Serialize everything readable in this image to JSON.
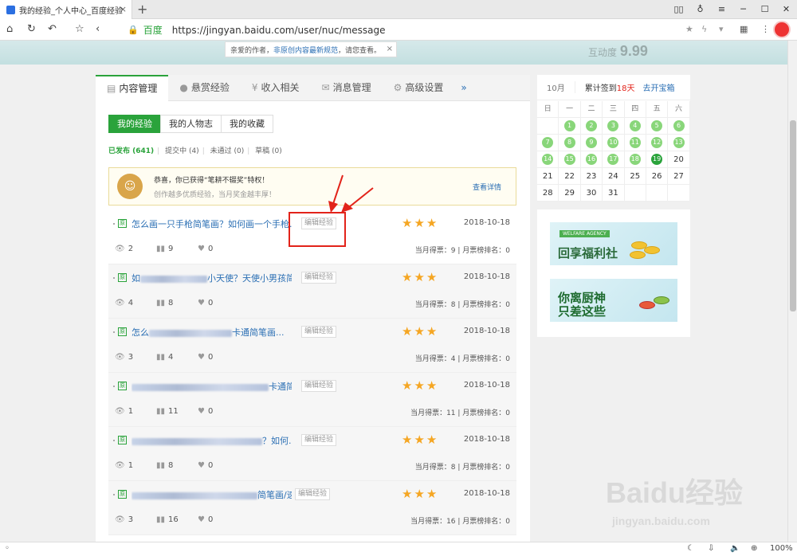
{
  "browser": {
    "tab_title": "我的经验_个人中心_百度经验",
    "tab_close": "×",
    "new_tab": "+",
    "site_label": "百度",
    "url": "https://jingyan.baidu.com/user/nuc/message",
    "zoom": "100%"
  },
  "banner": {
    "notice_prefix": "亲爱的作者，",
    "notice_link": "非原创内容最新规范",
    "notice_suffix": "，请您查看。",
    "close": "×",
    "score_label": "互动度",
    "score_value": "9.99"
  },
  "tabs": [
    {
      "icon": "▤",
      "label": "内容管理"
    },
    {
      "icon": "●",
      "label": "悬赏经验"
    },
    {
      "icon": "¥",
      "label": "收入相关"
    },
    {
      "icon": "✉",
      "label": "消息管理"
    },
    {
      "icon": "⚙",
      "label": "高级设置"
    },
    {
      "icon": "»",
      "label": ""
    }
  ],
  "subtabs": [
    "我的经验",
    "我的人物志",
    "我的收藏"
  ],
  "filters": {
    "published": "已发布 (641)",
    "submitting": "提交中 (4)",
    "rejected": "未通过 (0)",
    "draft": "草稿 (0)",
    "sep": "|"
  },
  "honor": {
    "line1": "恭喜，你已获得“笔耕不辍奖”特权！",
    "line2": "创作越多优质经验，当月奖金越丰厚！",
    "detail": "查看详情"
  },
  "items": [
    {
      "badge": "原",
      "title_pre": "怎么画一只手枪简笔画？如何画一个手枪...",
      "title_post": "",
      "edit": "编辑经验",
      "date": "2018-10-18",
      "views": "2",
      "votes": "9",
      "likes": "0",
      "monthly": "当月得票：9 | 月票榜排名：0"
    },
    {
      "badge": "原",
      "title_pre": "如",
      "title_post": "小天使？天使小男孩简...",
      "edit": "编辑经验",
      "date": "2018-10-18",
      "views": "4",
      "votes": "8",
      "likes": "0",
      "monthly": "当月得票：8 | 月票榜排名：0"
    },
    {
      "badge": "原",
      "title_pre": "怎么",
      "title_post": "卡通简笔画...",
      "edit": "编辑经验",
      "date": "2018-10-18",
      "views": "3",
      "votes": "4",
      "likes": "0",
      "monthly": "当月得票：4 | 月票榜排名：0"
    },
    {
      "badge": "原",
      "title_pre": "",
      "title_post": "卡通简笔画...",
      "edit": "编辑经验",
      "date": "2018-10-18",
      "views": "1",
      "votes": "11",
      "likes": "0",
      "monthly": "当月得票：11 | 月票榜排名：0"
    },
    {
      "badge": "原",
      "title_pre": "",
      "title_post": "？如何...",
      "edit": "编辑经验",
      "date": "2018-10-18",
      "views": "1",
      "votes": "8",
      "likes": "0",
      "monthly": "当月得票：8 | 月票榜排名：0"
    },
    {
      "badge": "原",
      "title_pre": "",
      "title_post": "简笔画/速...",
      "edit": "编辑经验",
      "date": "2018-10-18",
      "views": "3",
      "votes": "16",
      "likes": "0",
      "monthly": "当月得票：16 | 月票榜排名：0"
    }
  ],
  "stars": "★★★",
  "calendar": {
    "month": "10月",
    "signed_prefix": "累计签到",
    "signed_days": "18天",
    "treasure_link": "去开宝箱",
    "weekdays": [
      "日",
      "一",
      "二",
      "三",
      "四",
      "五",
      "六"
    ],
    "weeks": [
      [
        "",
        "1",
        "2",
        "3",
        "4",
        "5",
        "6"
      ],
      [
        "7",
        "8",
        "9",
        "10",
        "11",
        "12",
        "13"
      ],
      [
        "14",
        "15",
        "16",
        "17",
        "18",
        "19",
        "20"
      ],
      [
        "21",
        "22",
        "23",
        "24",
        "25",
        "26",
        "27"
      ],
      [
        "28",
        "29",
        "30",
        "31",
        "",
        "",
        ""
      ]
    ],
    "signed": [
      "1",
      "2",
      "3",
      "4",
      "5",
      "6",
      "7",
      "8",
      "9",
      "10",
      "11",
      "12",
      "13",
      "14",
      "15",
      "16",
      "17",
      "18",
      "19"
    ],
    "today": "19"
  },
  "ads": [
    {
      "tag": "WELFARE AGENCY",
      "text": "回享福利社"
    },
    {
      "tag": "",
      "text": "你离厨神只差这些"
    }
  ],
  "watermark": {
    "brand": "Baidu经验",
    "url": "jingyan.baidu.com"
  }
}
